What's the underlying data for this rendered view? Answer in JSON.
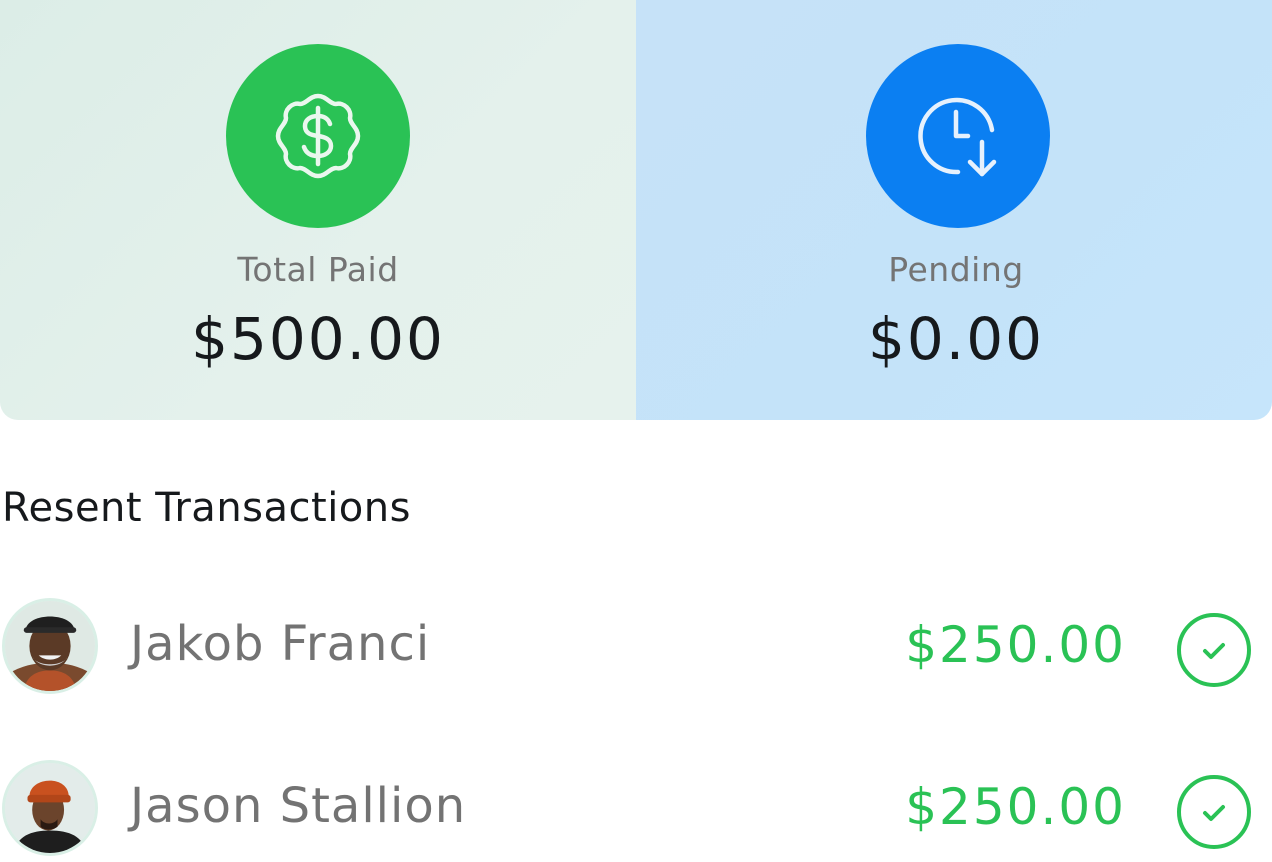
{
  "summary": {
    "total_paid": {
      "icon": "dollar-badge-icon",
      "label": "Total Paid",
      "amount": "$500.00",
      "color": "#2ac255"
    },
    "pending": {
      "icon": "clock-arrow-down-icon",
      "label": "Pending",
      "amount": "$0.00",
      "color": "#0b7ff2"
    }
  },
  "transactions": {
    "title": "Resent Transactions",
    "items": [
      {
        "name": "Jakob Franci",
        "amount": "$250.00",
        "status_icon": "check-circle-icon",
        "status_color": "#2ac255"
      },
      {
        "name": "Jason Stallion",
        "amount": "$250.00",
        "status_icon": "check-circle-icon",
        "status_color": "#2ac255"
      }
    ]
  }
}
